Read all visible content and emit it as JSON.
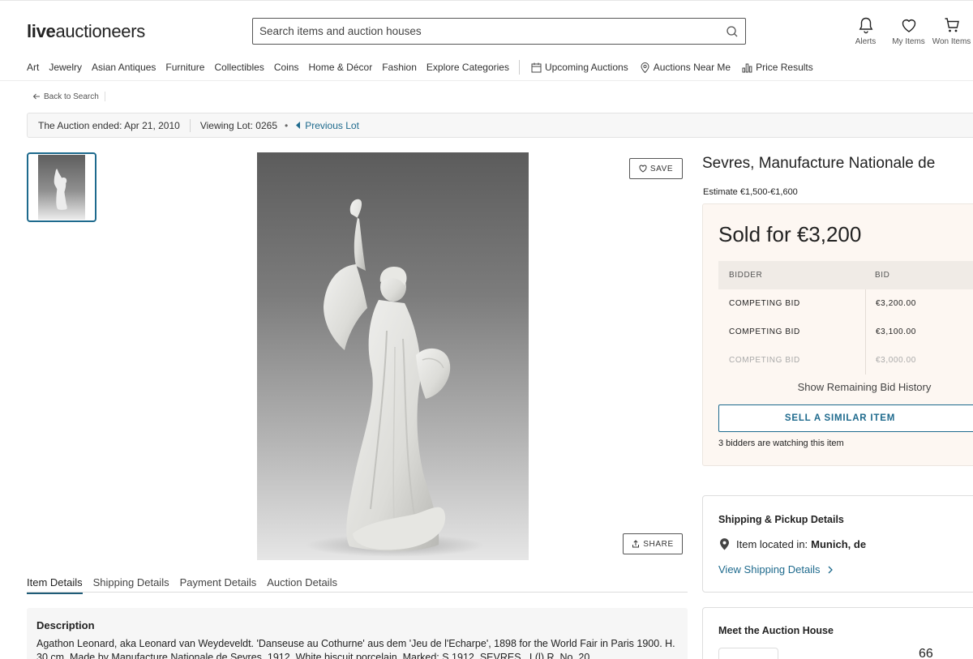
{
  "header": {
    "logo_bold": "live",
    "logo_light": "auctioneers",
    "search_placeholder": "Search items and auction houses",
    "actions": [
      {
        "label": "Alerts",
        "icon": "bell-icon"
      },
      {
        "label": "My Items",
        "icon": "heart-icon"
      },
      {
        "label": "Won Items",
        "icon": "cart-icon"
      }
    ]
  },
  "nav": {
    "categories": [
      "Art",
      "Jewelry",
      "Asian Antiques",
      "Furniture",
      "Collectibles",
      "Coins",
      "Home & Décor",
      "Fashion",
      "Explore Categories"
    ],
    "upcoming": "Upcoming Auctions",
    "near_me": "Auctions Near Me",
    "price_results": "Price Results"
  },
  "back_label": "Back to Search",
  "banner": {
    "ended": "The Auction ended: Apr 21, 2010",
    "viewing": "Viewing Lot: 0265",
    "dot": "•",
    "previous": "Previous Lot"
  },
  "image_buttons": {
    "save": "SAVE",
    "share": "SHARE"
  },
  "tabs": [
    "Item Details",
    "Shipping Details",
    "Payment Details",
    "Auction Details"
  ],
  "description": {
    "title": "Description",
    "text": "Agathon Leonard, aka Leonard van Weydeveldt. 'Danseuse au Cothurne' aus dem 'Jeu de l'Echarpe', 1898 for the World Fair in Paris 1900. H. 30 cm. Made by Manufacture Nationale de Sevres, 1912. White biscuit porcelain. Marked: S 1912, SEVRES., L(l) R, No. 20."
  },
  "lot": {
    "title": "Sevres, Manufacture Nationale de",
    "estimate": "Estimate €1,500-€1,600"
  },
  "sold": {
    "title": "Sold for €3,200",
    "col_bidder": "BIDDER",
    "col_bid": "BID",
    "rows": [
      {
        "bidder": "COMPETING BID",
        "bid": "€3,200.00"
      },
      {
        "bidder": "COMPETING BID",
        "bid": "€3,100.00"
      },
      {
        "bidder": "COMPETING BID",
        "bid": "€3,000.00"
      }
    ],
    "show_remaining": "Show Remaining Bid History",
    "sell_button": "SELL A SIMILAR ITEM",
    "watchers": "3 bidders are watching this item"
  },
  "shipping": {
    "title": "Shipping & Pickup Details",
    "location_label": "Item located in:",
    "location_value": "Munich, de",
    "link": "View Shipping Details"
  },
  "auction_house": {
    "title": "Meet the Auction House",
    "number": "66"
  }
}
